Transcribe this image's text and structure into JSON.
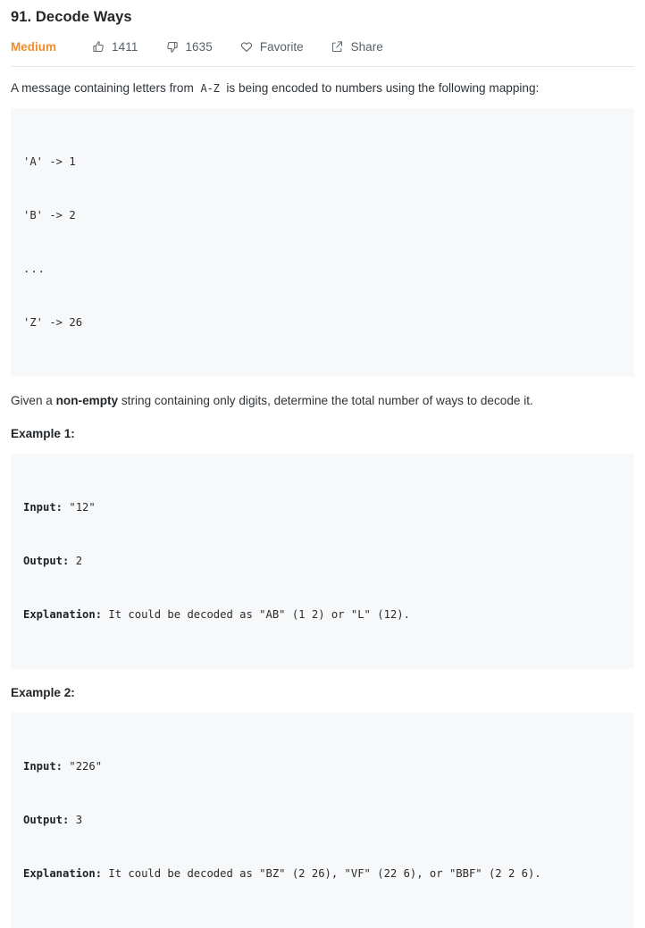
{
  "problem": {
    "title": "91. Decode Ways",
    "difficulty": "Medium",
    "likes": "1411",
    "dislikes": "1635",
    "favorite_label": "Favorite",
    "share_label": "Share",
    "icons": {
      "like": "thumbs-up-icon",
      "dislike": "thumbs-down-icon",
      "favorite": "heart-icon",
      "share": "share-box-icon"
    },
    "accent_color": "#ef8f29",
    "code_bg_color": "#f7f8fa",
    "text_color": "#2e3338"
  },
  "description": {
    "intro_before": "A message containing letters from",
    "intro_code": "A-Z",
    "intro_after": "is being encoded to numbers using the following mapping:",
    "mapping_code": "'A' -> 1\n'B' -> 2\n...\n'Z' -> 26",
    "mapping_lines": [
      "'A' -> 1",
      "'B' -> 2",
      "...",
      "'Z' -> 26"
    ],
    "task_before": "Given a ",
    "task_bold": "non-empty",
    "task_after": " string containing only digits, determine the total number of ways to decode it."
  },
  "examples": [
    {
      "heading": "Example 1:",
      "input_label": "Input:",
      "input_value": " \"12\"",
      "output_label": "Output:",
      "output_value": " 2",
      "explanation_label": "Explanation:",
      "explanation_value": " It could be decoded as \"AB\" (1 2) or \"L\" (12)."
    },
    {
      "heading": "Example 2:",
      "input_label": "Input:",
      "input_value": " \"226\"",
      "output_label": "Output:",
      "output_value": " 3",
      "explanation_label": "Explanation:",
      "explanation_value": " It could be decoded as \"BZ\" (2 26), \"VF\" (22 6), or \"BBF\" (2 2 6)."
    }
  ]
}
